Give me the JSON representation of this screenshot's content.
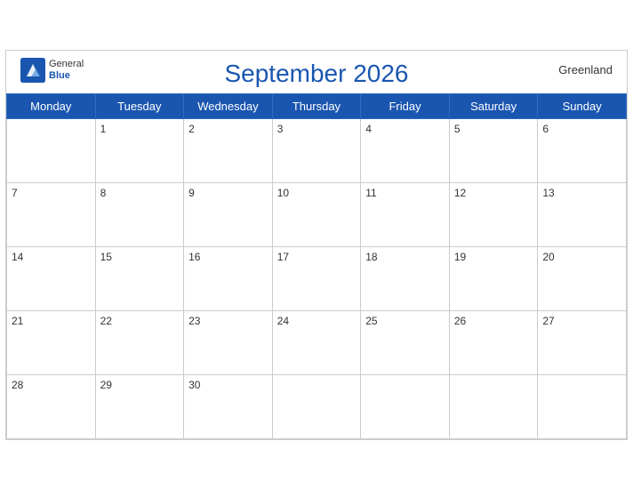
{
  "header": {
    "title": "September 2026",
    "region": "Greenland",
    "logo_general": "General",
    "logo_blue": "Blue"
  },
  "weekdays": [
    "Monday",
    "Tuesday",
    "Wednesday",
    "Thursday",
    "Friday",
    "Saturday",
    "Sunday"
  ],
  "weeks": [
    [
      null,
      1,
      2,
      3,
      4,
      5,
      6
    ],
    [
      7,
      8,
      9,
      10,
      11,
      12,
      13
    ],
    [
      14,
      15,
      16,
      17,
      18,
      19,
      20
    ],
    [
      21,
      22,
      23,
      24,
      25,
      26,
      27
    ],
    [
      28,
      29,
      30,
      null,
      null,
      null,
      null
    ]
  ]
}
